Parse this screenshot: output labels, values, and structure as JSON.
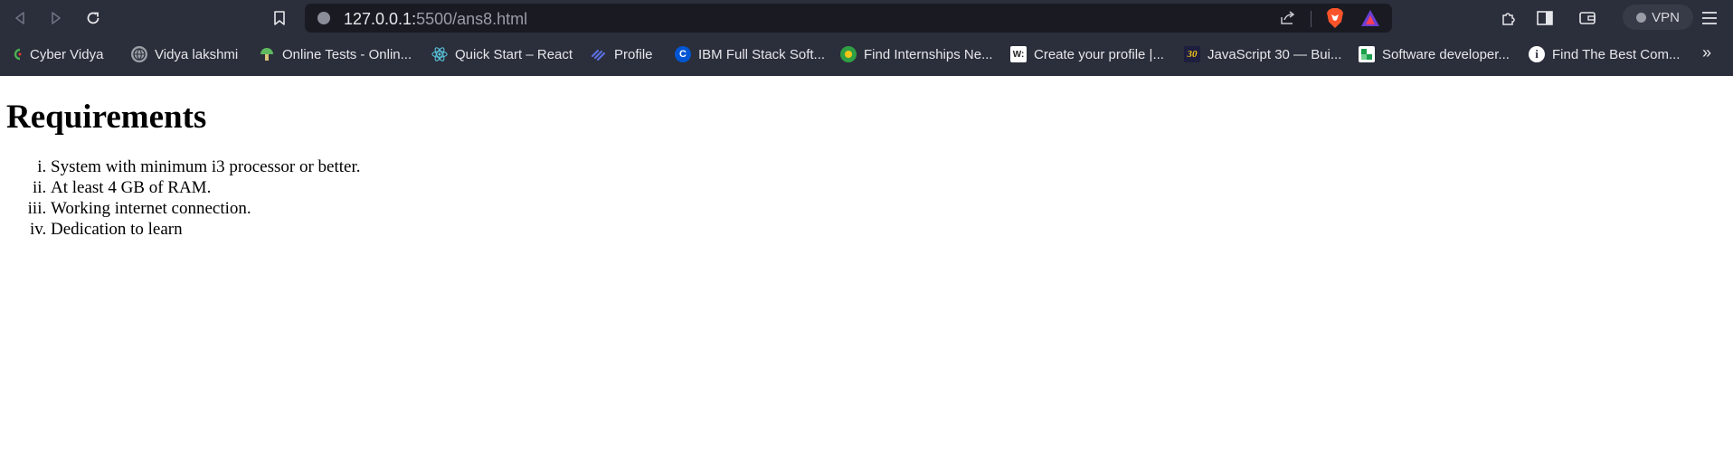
{
  "browser": {
    "url_host": "127.0.0.1:",
    "url_rest": "5500/ans8.html",
    "vpn_label": "VPN",
    "more_icon": "double-chevron-right-icon",
    "bookmarks": [
      {
        "label": "Cyber Vidya",
        "icon": "cyber-vidya-icon",
        "color": "#4caf50"
      },
      {
        "label": "Vidya lakshmi",
        "icon": "globe-icon",
        "color": "#9aa0a6"
      },
      {
        "label": "Online Tests - Onlin...",
        "icon": "mushroom-icon",
        "color": "#5fb85f"
      },
      {
        "label": "Quick Start – React",
        "icon": "react-icon",
        "color": "#58c4dc"
      },
      {
        "label": "Profile",
        "icon": "profile-logo-icon",
        "color": "#5b6ee1"
      },
      {
        "label": "IBM Full Stack Soft...",
        "icon": "coursera-icon",
        "color": "#0056d2"
      },
      {
        "label": "Find Internships Ne...",
        "icon": "internship-icon",
        "color": "#2f9e44"
      },
      {
        "label": "Create your profile |...",
        "icon": "w-icon",
        "color": "#ffffff"
      },
      {
        "label": "JavaScript 30 — Bui...",
        "icon": "js30-icon",
        "color": "#1e1e3f"
      },
      {
        "label": "Software developer...",
        "icon": "green-square-icon",
        "color": "#1a9f4a"
      },
      {
        "label": "Find The Best Com...",
        "icon": "info-circle-icon",
        "color": "#ffffff"
      }
    ]
  },
  "page": {
    "title": "Requirements",
    "requirements": [
      "System with minimum i3 processor or better.",
      "At least 4 GB of RAM.",
      "Working internet connection.",
      "Dedication to learn"
    ]
  }
}
